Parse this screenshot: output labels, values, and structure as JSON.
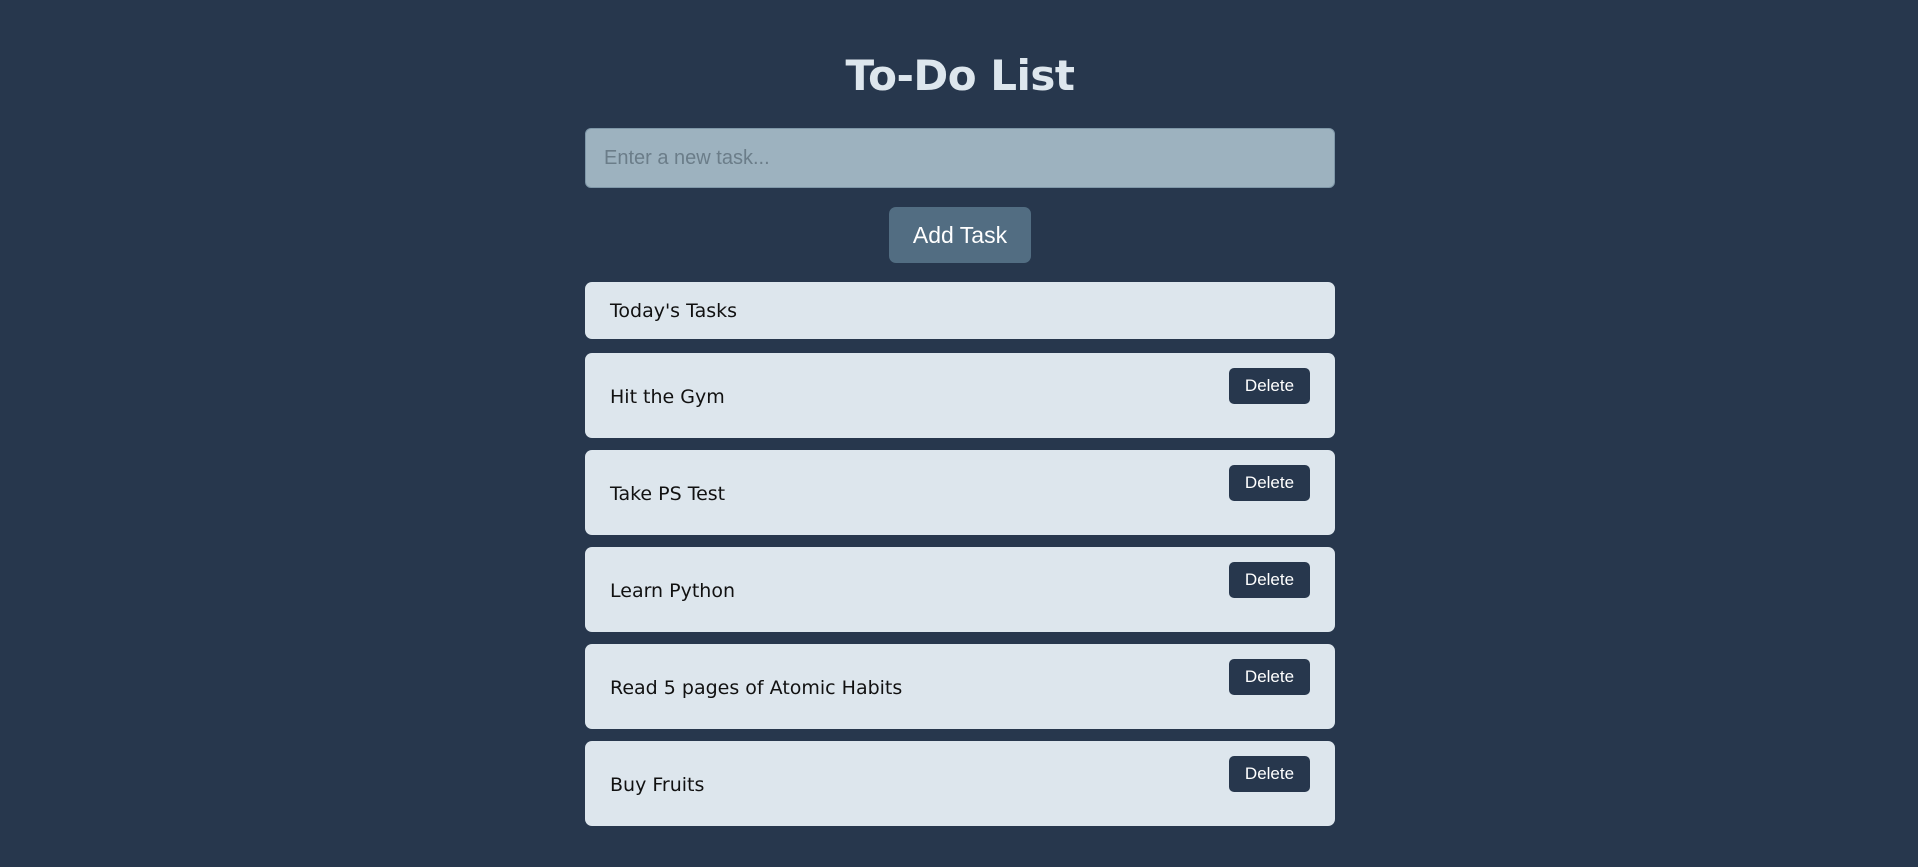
{
  "header": {
    "title": "To-Do List"
  },
  "new_task": {
    "placeholder": "Enter a new task...",
    "value": "",
    "add_label": "Add Task"
  },
  "list": {
    "heading": "Today's Tasks",
    "delete_label": "Delete",
    "tasks": [
      {
        "text": "Hit the Gym"
      },
      {
        "text": "Take PS Test"
      },
      {
        "text": "Learn Python"
      },
      {
        "text": "Read 5 pages of Atomic Habits"
      },
      {
        "text": "Buy Fruits"
      }
    ]
  },
  "colors": {
    "background": "#27374d",
    "input_background": "#9db2bf",
    "button_background": "#526d82",
    "card_background": "#dde6ed",
    "delete_background": "#27374d",
    "title_color": "#dde6ed"
  }
}
